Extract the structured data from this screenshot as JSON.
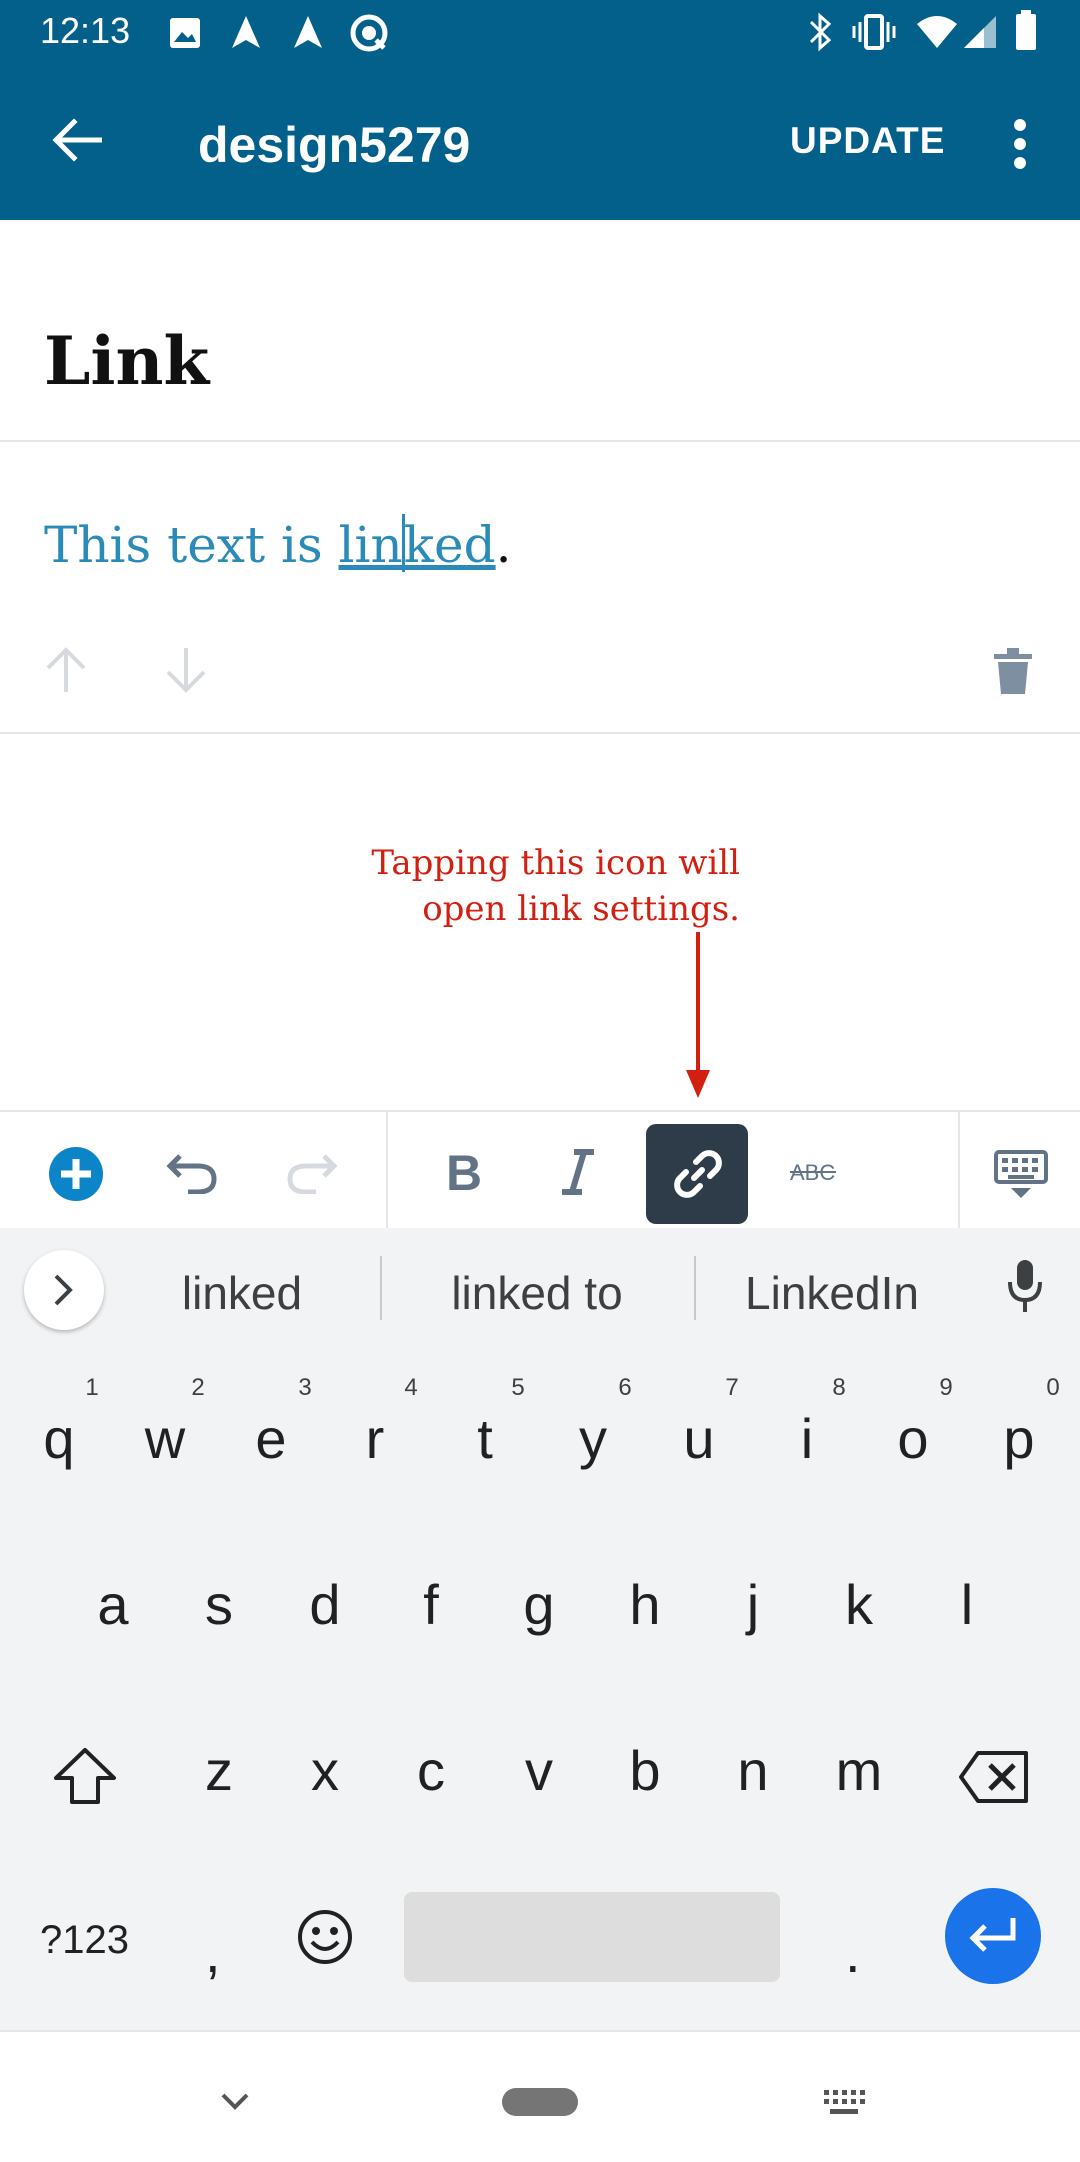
{
  "status_bar": {
    "time": "12:13"
  },
  "app_bar": {
    "title": "design5279",
    "update_label": "UPDATE"
  },
  "editor": {
    "heading": "Link",
    "paragraph": {
      "before": "This text is ",
      "link_part1": "lin",
      "link_part2": "ked",
      "after": "."
    }
  },
  "annotation": {
    "line1": "Tapping this icon will",
    "line2": "open link settings."
  },
  "toolbar": {
    "strikethrough_label": "ABC"
  },
  "suggestions": [
    "linked",
    "linked to",
    "LinkedIn"
  ],
  "keyboard": {
    "row1": [
      "q",
      "w",
      "e",
      "r",
      "t",
      "y",
      "u",
      "i",
      "o",
      "p"
    ],
    "row1_hints": [
      "1",
      "2",
      "3",
      "4",
      "5",
      "6",
      "7",
      "8",
      "9",
      "0"
    ],
    "row2": [
      "a",
      "s",
      "d",
      "f",
      "g",
      "h",
      "j",
      "k",
      "l"
    ],
    "row3": [
      "z",
      "x",
      "c",
      "v",
      "b",
      "n",
      "m"
    ],
    "symbols_label": "?123",
    "comma": ",",
    "period": "."
  },
  "colors": {
    "app_bar": "#03608a",
    "link_text": "#2a8ab8",
    "annotation": "#d21f10",
    "active_button": "#2e3c4a",
    "enter_key": "#1a73e8"
  }
}
